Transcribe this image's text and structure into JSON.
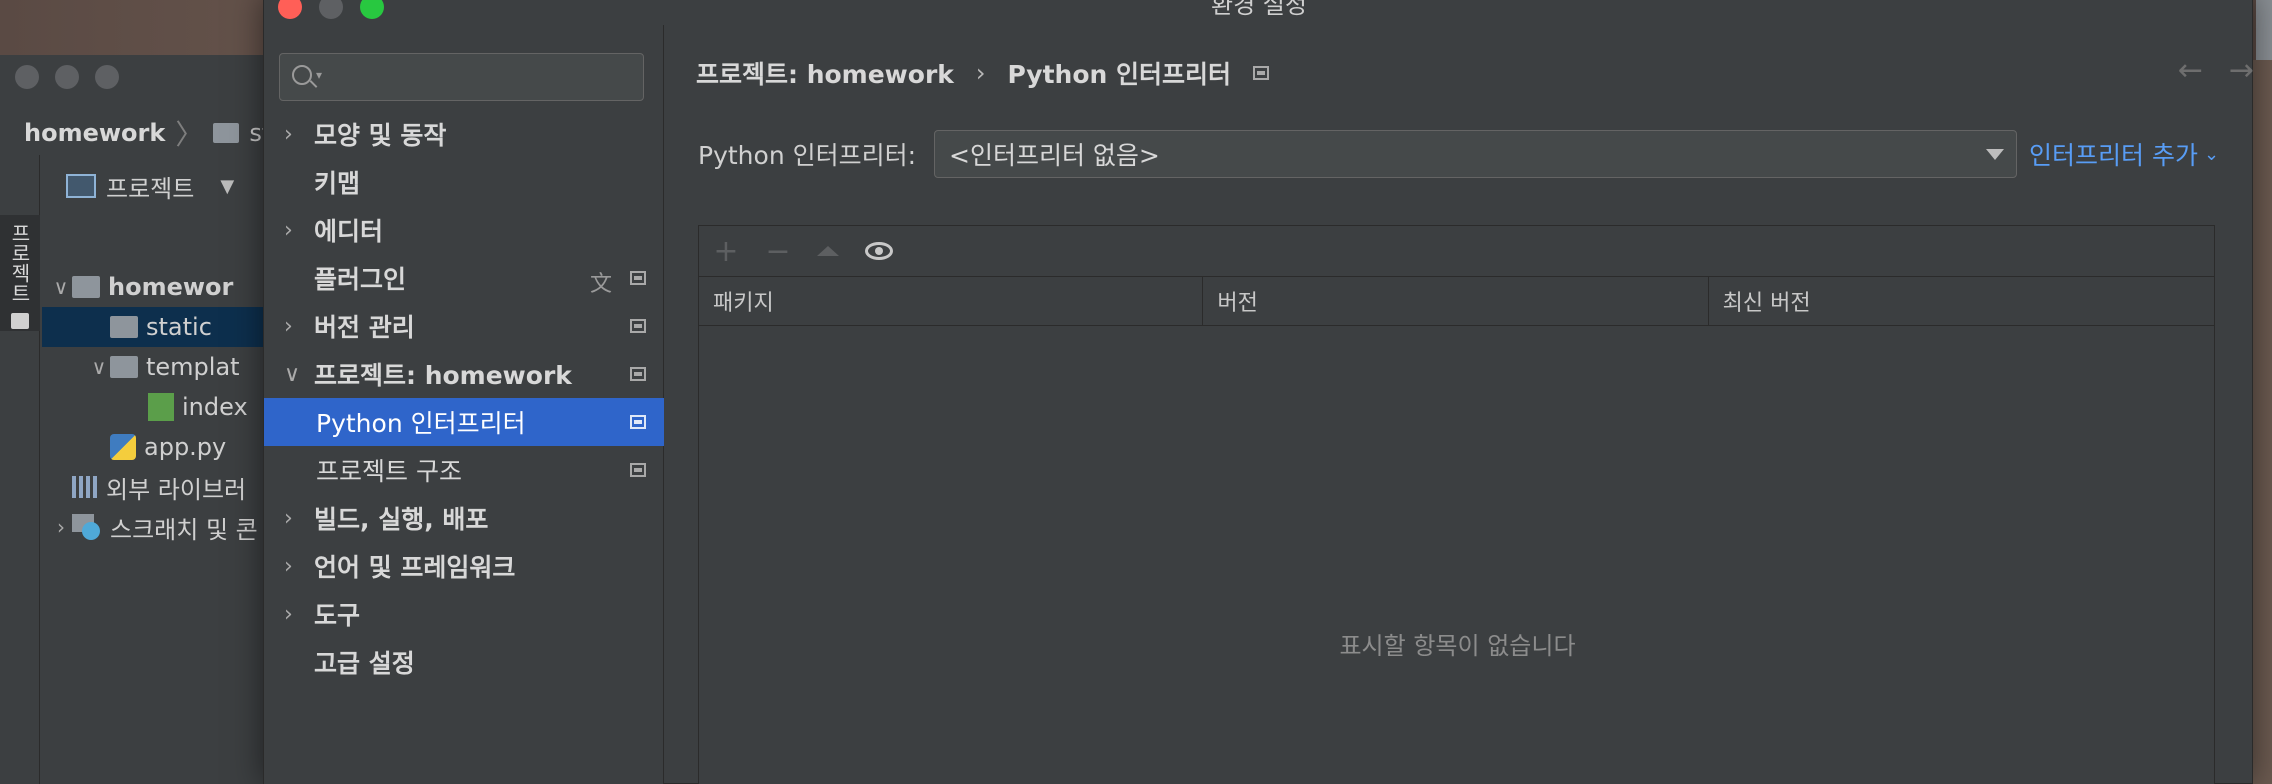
{
  "dialog": {
    "title": "환경 설정"
  },
  "ide": {
    "breadcrumb": {
      "project": "homework",
      "folder": "sta"
    },
    "side_tab_label": "프로젝트",
    "toolbar_label": "프로젝트",
    "tree": [
      {
        "label": "homewor",
        "chev": "∨",
        "icon": "folder-icon",
        "indent": 0,
        "selected": false,
        "bold": true
      },
      {
        "label": "static",
        "chev": "",
        "icon": "folder-icon",
        "indent": 1,
        "selected": true,
        "bold": false
      },
      {
        "label": "templat",
        "chev": "∨",
        "icon": "folder-icon",
        "indent": 1,
        "selected": false,
        "bold": false
      },
      {
        "label": "index",
        "chev": "",
        "icon": "html-file-icon",
        "indent": 2,
        "selected": false,
        "bold": false
      },
      {
        "label": "app.py",
        "chev": "",
        "icon": "python-file-icon",
        "indent": 1,
        "selected": false,
        "bold": false
      },
      {
        "label": "외부 라이브러",
        "chev": "",
        "icon": "library-icon",
        "indent": 0,
        "selected": false,
        "bold": false
      },
      {
        "label": "스크래치 및 콘",
        "chev": "›",
        "icon": "scratch-icon",
        "indent": 0,
        "selected": false,
        "bold": false
      }
    ]
  },
  "nav": {
    "search_placeholder": "",
    "items": [
      {
        "label": "모양 및 동작",
        "chev": "›",
        "sub": false,
        "selected": false,
        "proj": false,
        "trans": false
      },
      {
        "label": "키맵",
        "chev": "",
        "sub": false,
        "selected": false,
        "proj": false,
        "trans": false
      },
      {
        "label": "에디터",
        "chev": "›",
        "sub": false,
        "selected": false,
        "proj": false,
        "trans": false
      },
      {
        "label": "플러그인",
        "chev": "",
        "sub": false,
        "selected": false,
        "proj": true,
        "trans": true
      },
      {
        "label": "버전 관리",
        "chev": "›",
        "sub": false,
        "selected": false,
        "proj": true,
        "trans": false
      },
      {
        "label": "프로젝트: homework",
        "chev": "∨",
        "sub": false,
        "selected": false,
        "proj": true,
        "trans": false
      },
      {
        "label": "Python 인터프리터",
        "chev": "",
        "sub": true,
        "selected": true,
        "proj": true,
        "trans": false
      },
      {
        "label": "프로젝트 구조",
        "chev": "",
        "sub": true,
        "selected": false,
        "proj": true,
        "trans": false
      },
      {
        "label": "빌드, 실행, 배포",
        "chev": "›",
        "sub": false,
        "selected": false,
        "proj": false,
        "trans": false
      },
      {
        "label": "언어 및 프레임워크",
        "chev": "›",
        "sub": false,
        "selected": false,
        "proj": false,
        "trans": false
      },
      {
        "label": "도구",
        "chev": "›",
        "sub": false,
        "selected": false,
        "proj": false,
        "trans": false
      },
      {
        "label": "고급 설정",
        "chev": "",
        "sub": false,
        "selected": false,
        "proj": false,
        "trans": false
      }
    ]
  },
  "content": {
    "breadcrumb": {
      "parent": "프로젝트: homework",
      "separator": "›",
      "current": "Python 인터프리터"
    },
    "nav_back": "←",
    "nav_forward": "→",
    "interpreter_label": "Python 인터프리터:",
    "interpreter_value": "<인터프리터 없음>",
    "add_interpreter": "인터프리터 추가",
    "add_interpreter_chevron": "⌄",
    "toolbar": {
      "add": "+",
      "remove": "−"
    },
    "table": {
      "columns": [
        "패키지",
        "버전",
        "최신 버전"
      ],
      "empty_text": "표시할 항목이 없습니다"
    }
  },
  "colors": {
    "accent": "#2f65ca",
    "link": "#589df6",
    "background": "#3c3f41"
  }
}
